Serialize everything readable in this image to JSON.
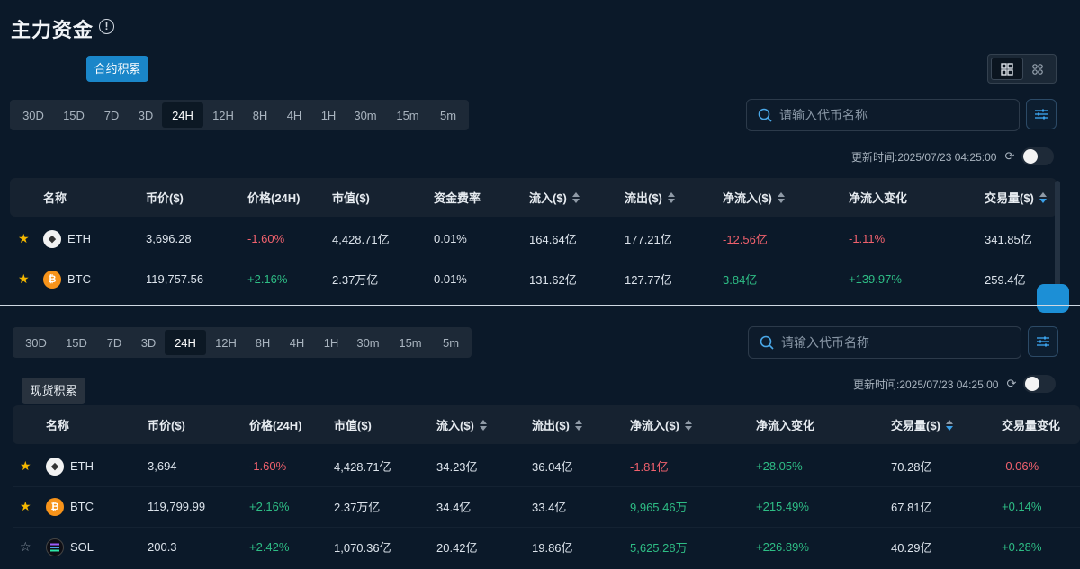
{
  "header": {
    "title": "主力资金",
    "info_icon": "info-icon"
  },
  "top_section": {
    "tag": "合约积累",
    "timeframes": [
      "30D",
      "15D",
      "7D",
      "3D",
      "24H",
      "12H",
      "8H",
      "4H",
      "1H",
      "30m",
      "15m",
      "5m"
    ],
    "active_timeframe": "24H",
    "search_placeholder": "请输入代币名称",
    "update_time": "更新时间:2025/07/23 04:25:00",
    "columns": [
      "名称",
      "币价($)",
      "价格(24H)",
      "市值($)",
      "资金费率",
      "流入($)",
      "流出($)",
      "净流入($)",
      "净流入变化",
      "交易量($)"
    ],
    "rows": [
      {
        "starred": true,
        "coin": "ETH",
        "price": "3,696.28",
        "change": "-1.60%",
        "mcap": "4,428.71亿",
        "funding": "0.01%",
        "inflow": "164.64亿",
        "outflow": "177.21亿",
        "netflow": "-12.56亿",
        "net_change": "-1.11%",
        "volume": "341.85亿"
      },
      {
        "starred": true,
        "coin": "BTC",
        "price": "119,757.56",
        "change": "+2.16%",
        "mcap": "2.37万亿",
        "funding": "0.01%",
        "inflow": "131.62亿",
        "outflow": "127.77亿",
        "netflow": "3.84亿",
        "net_change": "+139.97%",
        "volume": "259.4亿"
      }
    ]
  },
  "bottom_section": {
    "tag": "现货积累",
    "timeframes": [
      "30D",
      "15D",
      "7D",
      "3D",
      "24H",
      "12H",
      "8H",
      "4H",
      "1H",
      "30m",
      "15m",
      "5m"
    ],
    "active_timeframe": "24H",
    "search_placeholder": "请输入代币名称",
    "update_time": "更新时间:2025/07/23 04:25:00",
    "columns": [
      "名称",
      "币价($)",
      "价格(24H)",
      "市值($)",
      "流入($)",
      "流出($)",
      "净流入($)",
      "净流入变化",
      "交易量($)",
      "交易量变化"
    ],
    "rows": [
      {
        "starred": true,
        "coin": "ETH",
        "price": "3,694",
        "change": "-1.60%",
        "mcap": "4,428.71亿",
        "inflow": "34.23亿",
        "outflow": "36.04亿",
        "netflow": "-1.81亿",
        "net_change": "+28.05%",
        "volume": "70.28亿",
        "vol_change": "-0.06%"
      },
      {
        "starred": true,
        "coin": "BTC",
        "price": "119,799.99",
        "change": "+2.16%",
        "mcap": "2.37万亿",
        "inflow": "34.4亿",
        "outflow": "33.4亿",
        "netflow": "9,965.46万",
        "net_change": "+215.49%",
        "volume": "67.81亿",
        "vol_change": "+0.14%"
      },
      {
        "starred": false,
        "coin": "SOL",
        "price": "200.3",
        "change": "+2.42%",
        "mcap": "1,070.36亿",
        "inflow": "20.42亿",
        "outflow": "19.86亿",
        "netflow": "5,625.28万",
        "net_change": "+226.89%",
        "volume": "40.29亿",
        "vol_change": "+0.28%"
      }
    ]
  },
  "colors": {
    "background": "#0b1929",
    "positive": "#2ebd85",
    "negative": "#f0616d",
    "accent": "#1a86c9",
    "star": "#f5b800"
  }
}
